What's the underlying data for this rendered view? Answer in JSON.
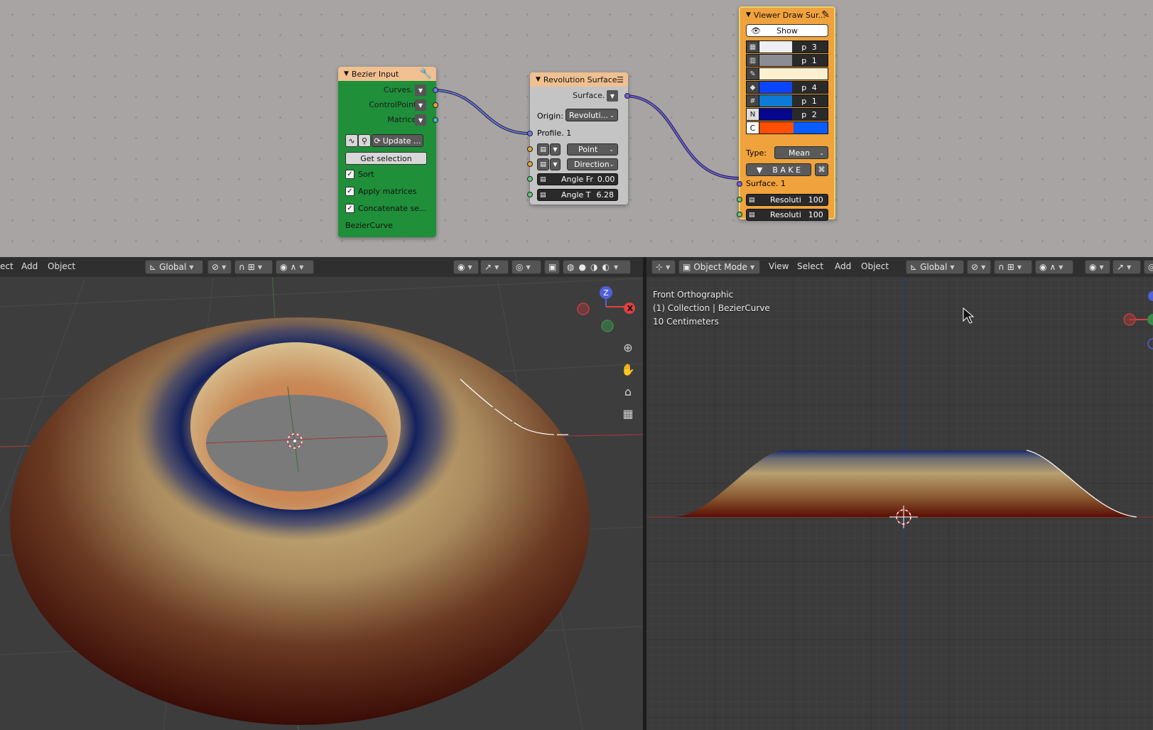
{
  "node_editor": {
    "bezier_input": {
      "title": "Bezier Input",
      "outputs": [
        "Curves. 1",
        "ControlPoints",
        "Matrices"
      ],
      "update_label": "Update ...",
      "get_selection_label": "Get selection",
      "checkboxes": [
        {
          "label": "Sort",
          "checked": true
        },
        {
          "label": "Apply matrices",
          "checked": true
        },
        {
          "label": "Concatenate se...",
          "checked": true
        }
      ],
      "object_name": "BezierCurve",
      "color": "#1f8f3a"
    },
    "revolution_surface": {
      "title": "Revolution Surface",
      "output": "Surface. 1",
      "origin_label": "Origin:",
      "origin_value": "Revoluti...",
      "profile_label": "Profile. 1",
      "point_value": "Point",
      "direction_value": "Direction",
      "angle_from_label": "Angle Fr",
      "angle_from_value": "0.00",
      "angle_to_label": "Angle T",
      "angle_to_value": "6.28"
    },
    "viewer_draw": {
      "title": "Viewer Draw Sur...",
      "show_label": "Show",
      "rows": [
        {
          "label": "p 3",
          "swatch": "#eeeef6"
        },
        {
          "label": "p 1",
          "swatch": "#8c8c94"
        },
        {
          "label": "",
          "swatch": "#fdf0d0"
        },
        {
          "label": "p 4",
          "swatch": "#0a44ff"
        },
        {
          "label": "p 1",
          "swatch": "#0c7ad8"
        },
        {
          "label": "p 2",
          "swatch": "#06068c"
        }
      ],
      "color_pair": [
        "#ff4f00",
        "#0a5cff"
      ],
      "color_row_letter": "C",
      "n_letter": "N",
      "type_label": "Type:",
      "type_value": "Mean",
      "bake_label": "B A K E",
      "surface_label": "Surface. 1",
      "resolution_rows": [
        {
          "label": "Resoluti",
          "value": "100"
        },
        {
          "label": "Resoluti",
          "value": "100"
        }
      ],
      "color": "#f0a23c"
    }
  },
  "left_viewport": {
    "menu": [
      "ect",
      "Add",
      "Object"
    ],
    "transform_orientation": "Global",
    "gizmo_axes": {
      "z": "Z",
      "x": "X"
    }
  },
  "right_viewport": {
    "mode": "Object Mode",
    "menu": [
      "View",
      "Select",
      "Add",
      "Object"
    ],
    "transform_orientation": "Global",
    "info": {
      "view_name": "Front Orthographic",
      "collection": "(1) Collection | BezierCurve",
      "scale": "10 Centimeters"
    }
  }
}
